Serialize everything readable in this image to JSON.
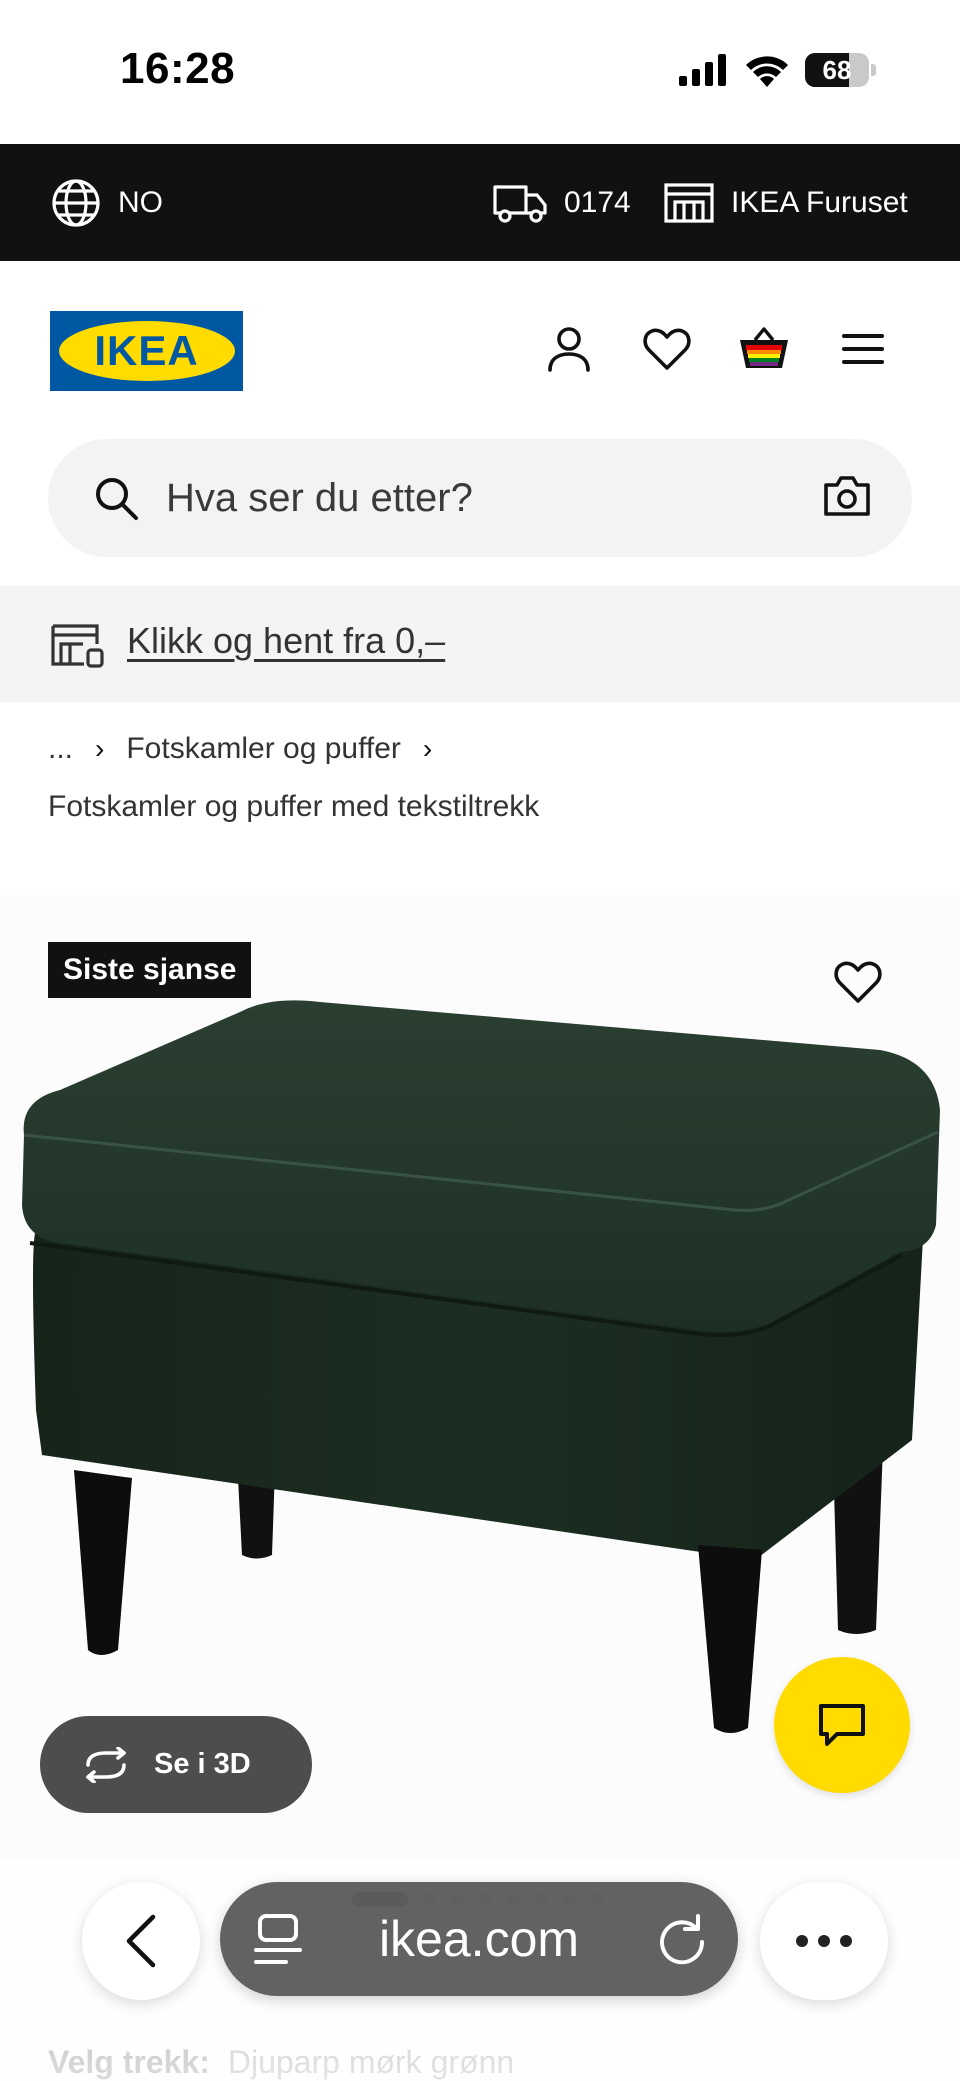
{
  "status_bar": {
    "time": "16:28",
    "battery": "68",
    "battery_level": 0.68
  },
  "top_bar": {
    "country": "NO",
    "postcode": "0174",
    "store": "IKEA Furuset"
  },
  "header": {
    "logo_text": "IKEA"
  },
  "search": {
    "placeholder": "Hva ser du etter?"
  },
  "promo": {
    "link_text": "Klikk og hent fra 0,–"
  },
  "breadcrumb": {
    "ellipsis": "...",
    "parent": "Fotskamler og puffer",
    "current": "Fotskamler og puffer med tekstiltrekk"
  },
  "product": {
    "badge": "Siste sjanse",
    "view_3d_label": "Se i 3D",
    "image_alt": "Fotskammel med mørk grønn tekstiltrekk og svarte ben",
    "carousel_total": 8,
    "carousel_active": 1,
    "cover_label": "Velg trekk:",
    "cover_value": "Djuparp mørk grønn"
  },
  "browser": {
    "url": "ikea.com"
  },
  "colors": {
    "topbar": "#111111",
    "ikea_blue": "#0058a3",
    "ikea_yellow": "#ffdb00",
    "upholstery": "#1c2d21"
  }
}
